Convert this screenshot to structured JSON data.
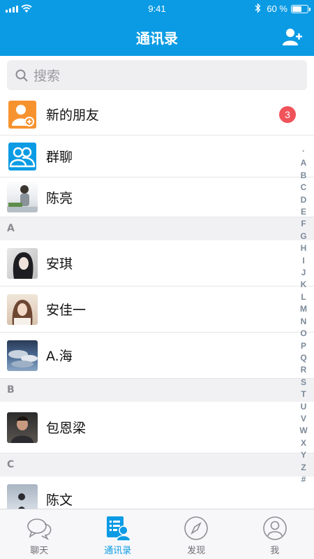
{
  "status_bar": {
    "time": "9:41",
    "battery": "60 %",
    "battery_level": 0.6
  },
  "header": {
    "title": "通讯录",
    "add_icon": "add-contact-icon"
  },
  "search": {
    "placeholder": "搜索"
  },
  "shortcuts": [
    {
      "label": "新的朋友",
      "icon": "new-friend-icon",
      "badge": "3"
    },
    {
      "label": "群聊",
      "icon": "group-chat-icon"
    }
  ],
  "top_contact": {
    "name": "陈亮"
  },
  "sections": [
    {
      "letter": "A",
      "contacts": [
        {
          "name": "安琪"
        },
        {
          "name": "安佳一"
        },
        {
          "name": "A.海"
        }
      ]
    },
    {
      "letter": "B",
      "contacts": [
        {
          "name": "包恩梁"
        }
      ]
    },
    {
      "letter": "C",
      "contacts": [
        {
          "name": "陈文"
        }
      ]
    }
  ],
  "index_letters": [
    "·",
    "A",
    "B",
    "C",
    "D",
    "E",
    "F",
    "G",
    "H",
    "I",
    "J",
    "K",
    "L",
    "M",
    "N",
    "O",
    "P",
    "Q",
    "R",
    "S",
    "T",
    "U",
    "V",
    "W",
    "X",
    "Y",
    "Z",
    "#"
  ],
  "tabs": [
    {
      "label": "聊天",
      "icon": "chat-icon"
    },
    {
      "label": "通讯录",
      "icon": "contacts-icon",
      "active": true
    },
    {
      "label": "发现",
      "icon": "compass-icon"
    },
    {
      "label": "我",
      "icon": "profile-icon"
    }
  ],
  "colors": {
    "accent": "#0b9be4",
    "badge": "#f0535a",
    "new_friend_icon": "#f7932f"
  }
}
